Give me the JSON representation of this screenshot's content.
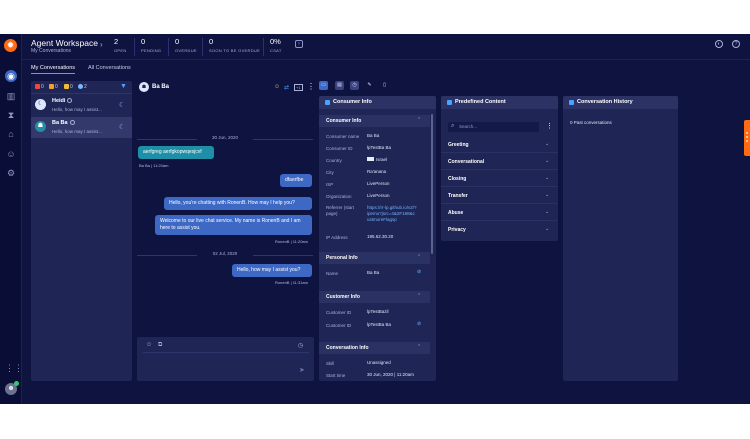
{
  "header": {
    "title": "Agent Workspace",
    "subtitle": "My Conversations",
    "stats": [
      {
        "value": "2",
        "label": "OPEN"
      },
      {
        "value": "0",
        "label": "PENDING"
      },
      {
        "value": "0",
        "label": "OVERDUE"
      },
      {
        "value": "0",
        "label": "SOON TO BE OVERDUE"
      },
      {
        "value": "0%",
        "label": "CSAT"
      }
    ]
  },
  "tabs": {
    "my": "My Conversations",
    "all": "All Conversations"
  },
  "filters": [
    {
      "icon": "chat-icon",
      "count": "0",
      "color": "#e74c3c"
    },
    {
      "icon": "message-icon",
      "count": "0",
      "color": "#f0a030"
    },
    {
      "icon": "agent-icon",
      "count": "0",
      "color": "#f0c030"
    },
    {
      "icon": "moon-icon",
      "count": "2",
      "color": "#7fb7ff"
    }
  ],
  "conversations": [
    {
      "name": "Heidi",
      "preview": "Hello, how may I assist...",
      "avatar_color": "#dfe6ff"
    },
    {
      "name": "Ba Ba",
      "preview": "Hello, how may I assist...",
      "avatar_color": "#dfe6ff"
    }
  ],
  "chat": {
    "contact": "Ba Ba",
    "messages": [
      {
        "day": "30 Jun, 2020"
      },
      {
        "text": "aerfgreg aerfgkopwqesjcvf",
        "dir": "in",
        "meta": "Ba Ba | 11:20am"
      },
      {
        "text": "dfaerfbe",
        "dir": "out"
      },
      {
        "text": "Hello, you're chatting with RonenB. How may I help you?",
        "dir": "out"
      },
      {
        "text": "Welcome to our live chat service. My name is RonenB and I am here to assist you.",
        "dir": "out",
        "meta": "RonenB | 11:20am"
      },
      {
        "day": "02 Jul, 2020"
      },
      {
        "text": "Hello, how may I assist you?",
        "dir": "out",
        "meta": "RonenB | 11:31am"
      }
    ]
  },
  "consumer_info": {
    "title": "Consumer Info",
    "sections": {
      "consumer": "Consumer Info",
      "personal": "Personal Info",
      "customer": "Customer Info",
      "conversation": "Conversation Info"
    },
    "consumer_rows": [
      {
        "k": "Consumer name",
        "v": "Ba Ba"
      },
      {
        "k": "Consumer ID",
        "v": "lpTestBa Ba"
      },
      {
        "k": "Country",
        "v": "Israel"
      },
      {
        "k": "City",
        "v": "Ra'anana"
      },
      {
        "k": "ISP",
        "v": "LivePerson"
      },
      {
        "k": "Organization",
        "v": "LivePerson"
      },
      {
        "k": "Referrer (start page)",
        "v": "https://rr-lp.github.io/v2/?ipemo?jsrc=4&2F168&custmoreFlagsp"
      },
      {
        "k": "IP Address",
        "v": "195.62.30.20"
      }
    ],
    "personal_rows": [
      {
        "k": "Name",
        "v": "Ba Ba"
      }
    ],
    "customer_rows": [
      {
        "k": "Customer ID",
        "v": "lpTestBazil"
      },
      {
        "k": "Customer ID",
        "v": "lpTestBa Ba"
      }
    ],
    "conversation_rows": [
      {
        "k": "Skill",
        "v": "Unassigned"
      },
      {
        "k": "Start time",
        "v": "30 Jun, 2020 | 11:20am"
      }
    ]
  },
  "predefined": {
    "title": "Predefined Content",
    "search_placeholder": "Search...",
    "categories": [
      "Greeting",
      "Conversational",
      "Closing",
      "Transfer",
      "Abuse",
      "Privacy"
    ]
  },
  "history": {
    "title": "Conversation History",
    "empty": "0 Past conversations"
  }
}
